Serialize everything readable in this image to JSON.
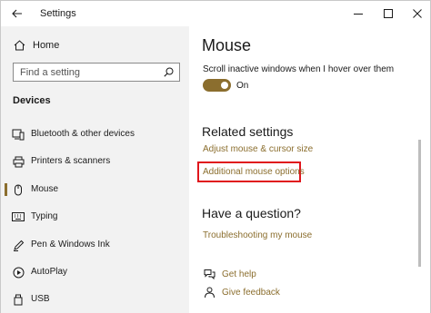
{
  "window": {
    "title": "Settings",
    "icons": {
      "back": "arrow-left-icon",
      "minimize": "minimize-icon",
      "maximize": "maximize-icon",
      "close": "close-icon"
    }
  },
  "sidebar": {
    "home_label": "Home",
    "search_placeholder": "Find a setting",
    "section_label": "Devices",
    "items": [
      {
        "label": "Bluetooth & other devices",
        "icon": "bluetooth-devices-icon",
        "selected": false
      },
      {
        "label": "Printers & scanners",
        "icon": "printer-icon",
        "selected": false
      },
      {
        "label": "Mouse",
        "icon": "mouse-icon",
        "selected": true
      },
      {
        "label": "Typing",
        "icon": "keyboard-icon",
        "selected": false
      },
      {
        "label": "Pen & Windows Ink",
        "icon": "pen-icon",
        "selected": false
      },
      {
        "label": "AutoPlay",
        "icon": "autoplay-icon",
        "selected": false
      },
      {
        "label": "USB",
        "icon": "usb-icon",
        "selected": false
      }
    ]
  },
  "main": {
    "page_title": "Mouse",
    "scroll_inactive_label": "Scroll inactive windows when I hover over them",
    "scroll_inactive_state": "On",
    "related_heading": "Related settings",
    "related_links": {
      "adjust": "Adjust mouse & cursor size",
      "additional": "Additional mouse options"
    },
    "question_heading": "Have a question?",
    "troubleshoot_link": "Troubleshooting my mouse",
    "help": {
      "get_help": "Get help",
      "give_feedback": "Give feedback"
    }
  },
  "colors": {
    "accent": "#8b6e2e",
    "highlight_box": "#e0161c",
    "sidebar_bg": "#f2f2f2"
  }
}
